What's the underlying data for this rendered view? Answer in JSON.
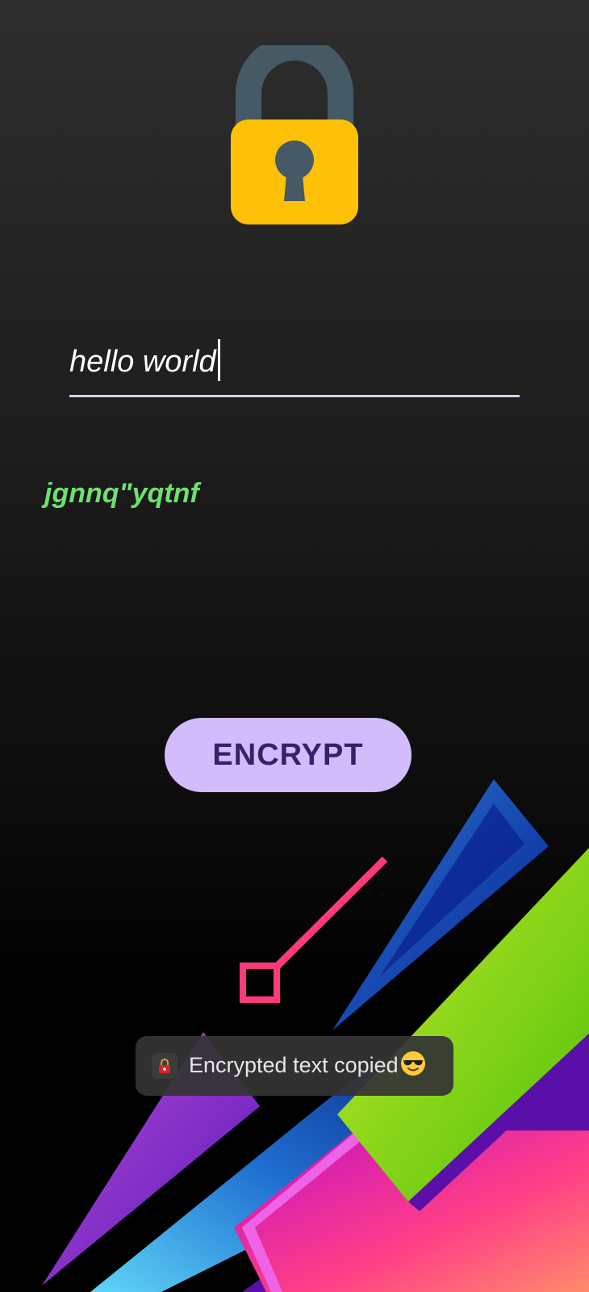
{
  "input": {
    "value": "hello world"
  },
  "result": {
    "text": "jgnnq\"yqtnf"
  },
  "encrypt_button": {
    "label": "ENCRYPT"
  },
  "toast": {
    "message": "Encrypted text copied"
  },
  "icons": {
    "header": "padlock-icon",
    "toast_app": "lock-icon",
    "toast_emoji": "sunglasses-face-icon"
  },
  "colors": {
    "lock_body": "#FFC107",
    "lock_shackle": "#455A64",
    "result_text": "#6FE06F",
    "button_bg": "#D3BCFB",
    "button_text": "#3A1F6B",
    "underline": "#D9CFEE"
  }
}
